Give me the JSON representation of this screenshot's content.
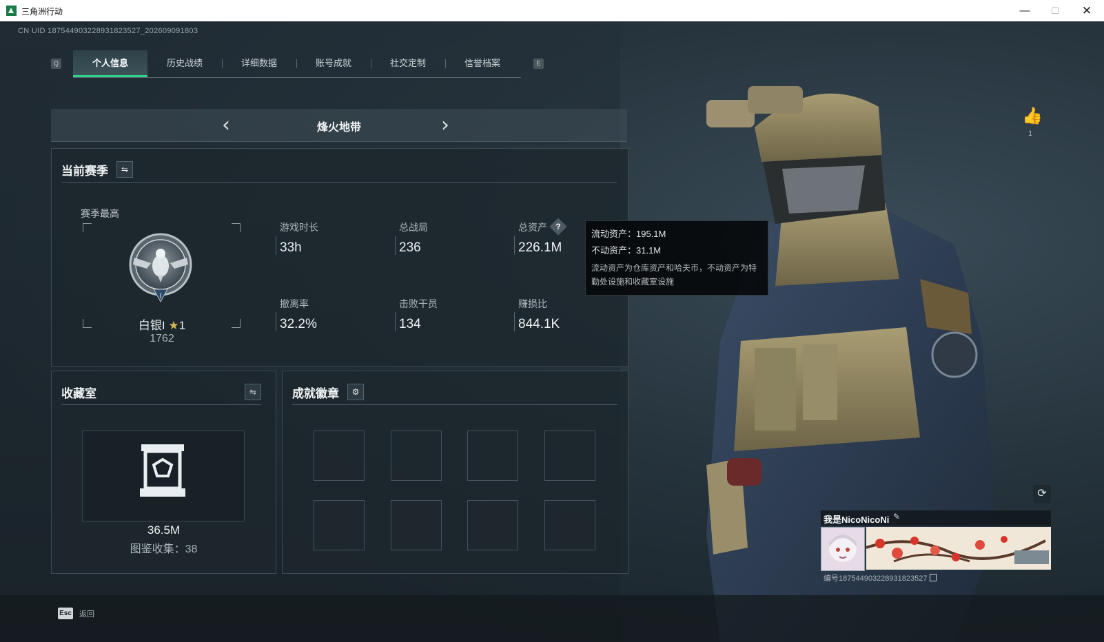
{
  "window": {
    "title": "三角洲行动",
    "minimize": "—",
    "maximize": "☐",
    "close": "✕"
  },
  "uid": "CN UID 187544903228931823527_202609091803",
  "tabs": {
    "q_key": "Q",
    "e_key": "E",
    "items": [
      {
        "label": "个人信息",
        "active": true
      },
      {
        "label": "历史战绩",
        "active": false
      },
      {
        "label": "详细数据",
        "active": false
      },
      {
        "label": "账号成就",
        "active": false
      },
      {
        "label": "社交定制",
        "active": false
      },
      {
        "label": "信誉档案",
        "active": false
      }
    ]
  },
  "mode": {
    "title": "烽火地带",
    "prev": "‹",
    "next": "›"
  },
  "season": {
    "title": "当前赛季",
    "switch_icon": "⇋",
    "rank_label": "赛季最高",
    "rank_name": "白银I",
    "rank_star": "★",
    "rank_stars_count": "1",
    "rank_score": "1762",
    "stats": [
      {
        "label": "游戏时长",
        "value": "33h"
      },
      {
        "label": "总战局",
        "value": "236"
      },
      {
        "label": "总资产",
        "value": "226.1M"
      },
      {
        "label": "撤离率",
        "value": "32.2%"
      },
      {
        "label": "击败干员",
        "value": "134"
      },
      {
        "label": "赚损比",
        "value": "844.1K"
      }
    ],
    "help": "?"
  },
  "tooltip": {
    "liquid": "流动资产：195.1M",
    "fixed": "不动资产：31.1M",
    "desc": "流动资产为仓库资产和哈夫币，不动资产为特勤处设施和收藏室设施"
  },
  "collection": {
    "title": "收藏室",
    "switch_icon": "⇋",
    "value": "36.5M",
    "count": "图鉴收集：38"
  },
  "achievements": {
    "title": "成就徽章",
    "gear_icon": "⚙"
  },
  "bottom": {
    "esc_key": "Esc",
    "esc_label": "返回"
  },
  "profile": {
    "like_icon": "👍",
    "likes": "1",
    "refresh_icon": "⟳",
    "name": "我是NicoNicoNi",
    "edit_icon": "✎",
    "id": "编号187544903228931823527"
  },
  "colors": {
    "accent": "#2fd38a",
    "panel": "#1c262d",
    "background": "#1b252c"
  }
}
